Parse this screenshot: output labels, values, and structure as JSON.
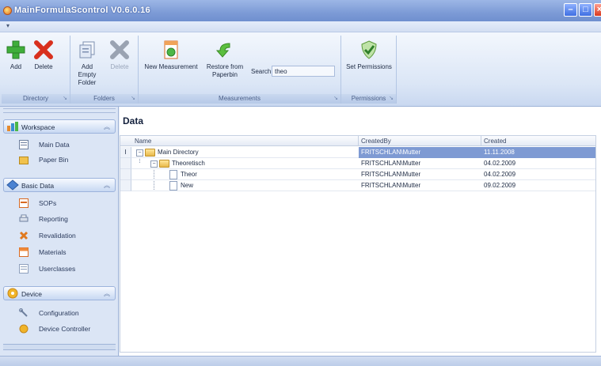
{
  "window": {
    "title": "MainFormulaScontrol  V0.6.0.16"
  },
  "ribbon": {
    "directory": {
      "label": "Directory",
      "add": "Add",
      "delete": "Delete"
    },
    "folders": {
      "label": "Folders",
      "add_empty_folder": "Add Empty Folder",
      "delete_folder": "Delete"
    },
    "measurements": {
      "label": "Measurements",
      "new_measurement": "New Measurement",
      "restore": "Restore from Paperbin",
      "search_label": "Search",
      "search_value": "theo"
    },
    "permissions": {
      "label": "Permissions",
      "set_permissions": "Set Permissions"
    }
  },
  "sidebar": {
    "workspace": {
      "title": "Workspace",
      "items": [
        {
          "label": "Main Data",
          "icon": "main-data-icon"
        },
        {
          "label": "Paper Bin",
          "icon": "folder-icon"
        }
      ]
    },
    "basic_data": {
      "title": "Basic Data",
      "items": [
        {
          "label": "SOPs",
          "icon": "sop-icon"
        },
        {
          "label": "Reporting",
          "icon": "printer-icon"
        },
        {
          "label": "Revalidation",
          "icon": "revalidation-icon"
        },
        {
          "label": "Materials",
          "icon": "materials-icon"
        },
        {
          "label": "Userclasses",
          "icon": "userclasses-icon"
        }
      ]
    },
    "device": {
      "title": "Device",
      "items": [
        {
          "label": "Configuration",
          "icon": "wrench-icon"
        },
        {
          "label": "Device Controller",
          "icon": "device-controller-icon"
        }
      ]
    }
  },
  "main": {
    "title": "Data",
    "columns": [
      "Name",
      "CreatedBy",
      "Created"
    ],
    "rows": [
      {
        "name": "Main Directory",
        "created_by": "FRITSCHLAN\\Mutter",
        "created": "11.11.2008"
      },
      {
        "name": "Theoretisch",
        "created_by": "FRITSCHLAN\\Mutter",
        "created": "04.02.2009"
      },
      {
        "name": "Theor",
        "created_by": "FRITSCHLAN\\Mutter",
        "created": "04.02.2009"
      },
      {
        "name": "New",
        "created_by": "FRITSCHLAN\\Mutter",
        "created": "09.02.2009"
      }
    ],
    "row_indicator": "I"
  },
  "colors": {
    "accent": "#7e9ad3",
    "title_bar": "#7d9bd6"
  }
}
